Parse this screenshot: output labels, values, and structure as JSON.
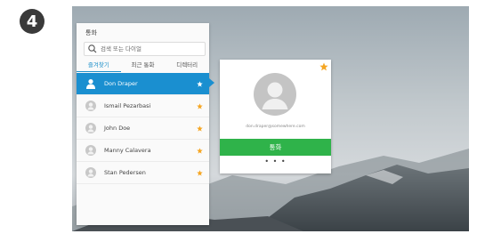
{
  "step_badge": "4",
  "panel": {
    "title": "통화",
    "search_placeholder": "검색 또는 다이얼",
    "tabs": [
      {
        "label": "즐겨찾기",
        "active": true
      },
      {
        "label": "최근 통화",
        "active": false
      },
      {
        "label": "디렉터리",
        "active": false
      }
    ],
    "contacts": [
      {
        "name": "Don Draper",
        "selected": true,
        "favorite": true
      },
      {
        "name": "Ismail Pezarbasi",
        "selected": false,
        "favorite": true
      },
      {
        "name": "John Doe",
        "selected": false,
        "favorite": true
      },
      {
        "name": "Manny Calavera",
        "selected": false,
        "favorite": true
      },
      {
        "name": "Stan Pedersen",
        "selected": false,
        "favorite": true
      }
    ]
  },
  "detail_card": {
    "email": "don.draper@somewhere.com",
    "call_label": "통화",
    "more_label": "• • •"
  },
  "colors": {
    "accent_blue": "#1a8fd0",
    "call_green": "#2fb34a",
    "star_orange": "#f5a623"
  }
}
